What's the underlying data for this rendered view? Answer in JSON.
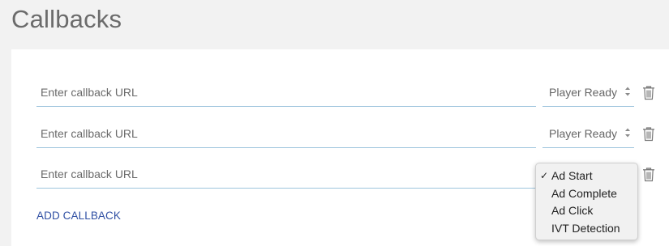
{
  "page": {
    "title": "Callbacks"
  },
  "callbacks": {
    "rows": [
      {
        "url_placeholder": "Enter callback URL",
        "url_value": "",
        "event": "Player Ready"
      },
      {
        "url_placeholder": "Enter callback URL",
        "url_value": "",
        "event": "Player Ready"
      },
      {
        "url_placeholder": "Enter callback URL",
        "url_value": "",
        "event": "Ad Start"
      }
    ],
    "add_label": "ADD CALLBACK"
  },
  "event_dropdown": {
    "open": true,
    "selected": "Ad Start",
    "check_mark": "✓",
    "options": [
      "Ad Start",
      "Ad Complete",
      "Ad Click",
      "IVT Detection"
    ]
  },
  "icons": {
    "delete": "trash-icon",
    "select": "up-down-chevron-icon",
    "selected": "checkmark-icon"
  },
  "colors": {
    "page_background": "#f2f2f2",
    "card_background": "#ffffff",
    "title_text": "#6b6b6b",
    "field_underline": "#9ec5dd",
    "link": "#2f4fa3",
    "dropdown_background": "#f1f1f1"
  }
}
